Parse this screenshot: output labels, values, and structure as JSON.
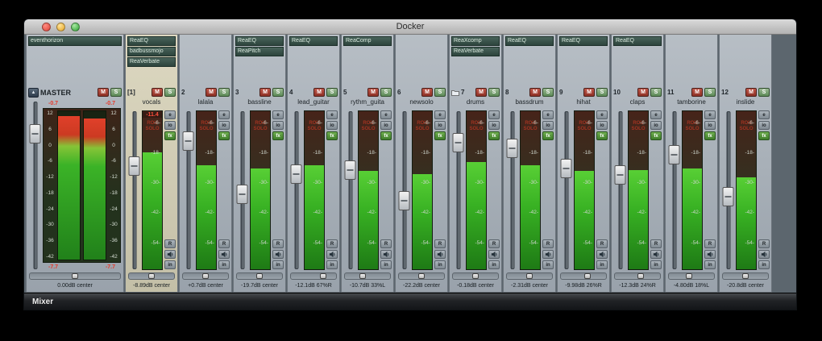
{
  "window": {
    "title": "Docker"
  },
  "dock_tab": {
    "label": "Mixer"
  },
  "mute_label": "M",
  "solo_label": "S",
  "strip_buttons": {
    "env": "e",
    "io": "io",
    "fx": "fx",
    "rec": "R",
    "input": "in"
  },
  "meter": {
    "scale_labels": [
      "-6-",
      "-18-",
      "-30-",
      "-42-",
      "-54-"
    ],
    "watermark": [
      "ROU",
      "SOLO"
    ]
  },
  "master": {
    "name": "MASTER",
    "mute_label": "M",
    "solo_label": "S",
    "menu_glyph": "▲",
    "fx": [
      "eventhorizon"
    ],
    "peak_left": "-0.7",
    "peak_right": "-0.7",
    "scale_labels": [
      "12",
      "6",
      "0",
      "-6",
      "-12",
      "-18",
      "-24",
      "-30",
      "-36",
      "-42"
    ],
    "readout_left": "-7.7",
    "readout_right": "-7.7",
    "volume_readout": "0.00dB center"
  },
  "channels": [
    {
      "number": "[1]",
      "name": "vocals",
      "fx": [
        "ReaEQ",
        "badbussmojo",
        "ReaVerbate"
      ],
      "peak": "-11.4",
      "volume_readout": "-8.89dB center",
      "selected": true,
      "level": 74
    },
    {
      "number": "2",
      "name": "lalala",
      "fx": [],
      "volume_readout": "+0.7dB center",
      "level": 66
    },
    {
      "number": "3",
      "name": "bassline",
      "fx": [
        "ReaEQ",
        "ReaPitch"
      ],
      "volume_readout": "-19.7dB center",
      "level": 64
    },
    {
      "number": "4",
      "name": "lead_guitar",
      "fx": [
        "ReaEQ"
      ],
      "volume_readout": "-12.1dB 67%R",
      "level": 66
    },
    {
      "number": "5",
      "name": "rythm_guita",
      "fx": [
        "ReaComp"
      ],
      "volume_readout": "-10.7dB 33%L",
      "level": 62
    },
    {
      "number": "6",
      "name": "newsolo",
      "fx": [],
      "volume_readout": "-22.2dB center",
      "level": 60
    },
    {
      "number": "7",
      "name": "drums",
      "folder": true,
      "fx": [
        "ReaXcomp",
        "ReaVerbate"
      ],
      "volume_readout": "-0.18dB center",
      "level": 68
    },
    {
      "number": "8",
      "name": "bassdrum",
      "fx": [
        "ReaEQ"
      ],
      "volume_readout": "-2.31dB center",
      "level": 66
    },
    {
      "number": "9",
      "name": "hihat",
      "fx": [
        "ReaEQ"
      ],
      "volume_readout": "-9.98dB 26%R",
      "level": 62
    },
    {
      "number": "10",
      "name": "claps",
      "fx": [
        "ReaEQ"
      ],
      "volume_readout": "-12.3dB 24%R",
      "level": 63
    },
    {
      "number": "11",
      "name": "tamborine",
      "fx": [],
      "volume_readout": "-4.80dB 18%L",
      "level": 64
    },
    {
      "number": "12",
      "name": "inslide",
      "fx": [],
      "volume_readout": "-20.8dB center",
      "level": 58
    }
  ]
}
